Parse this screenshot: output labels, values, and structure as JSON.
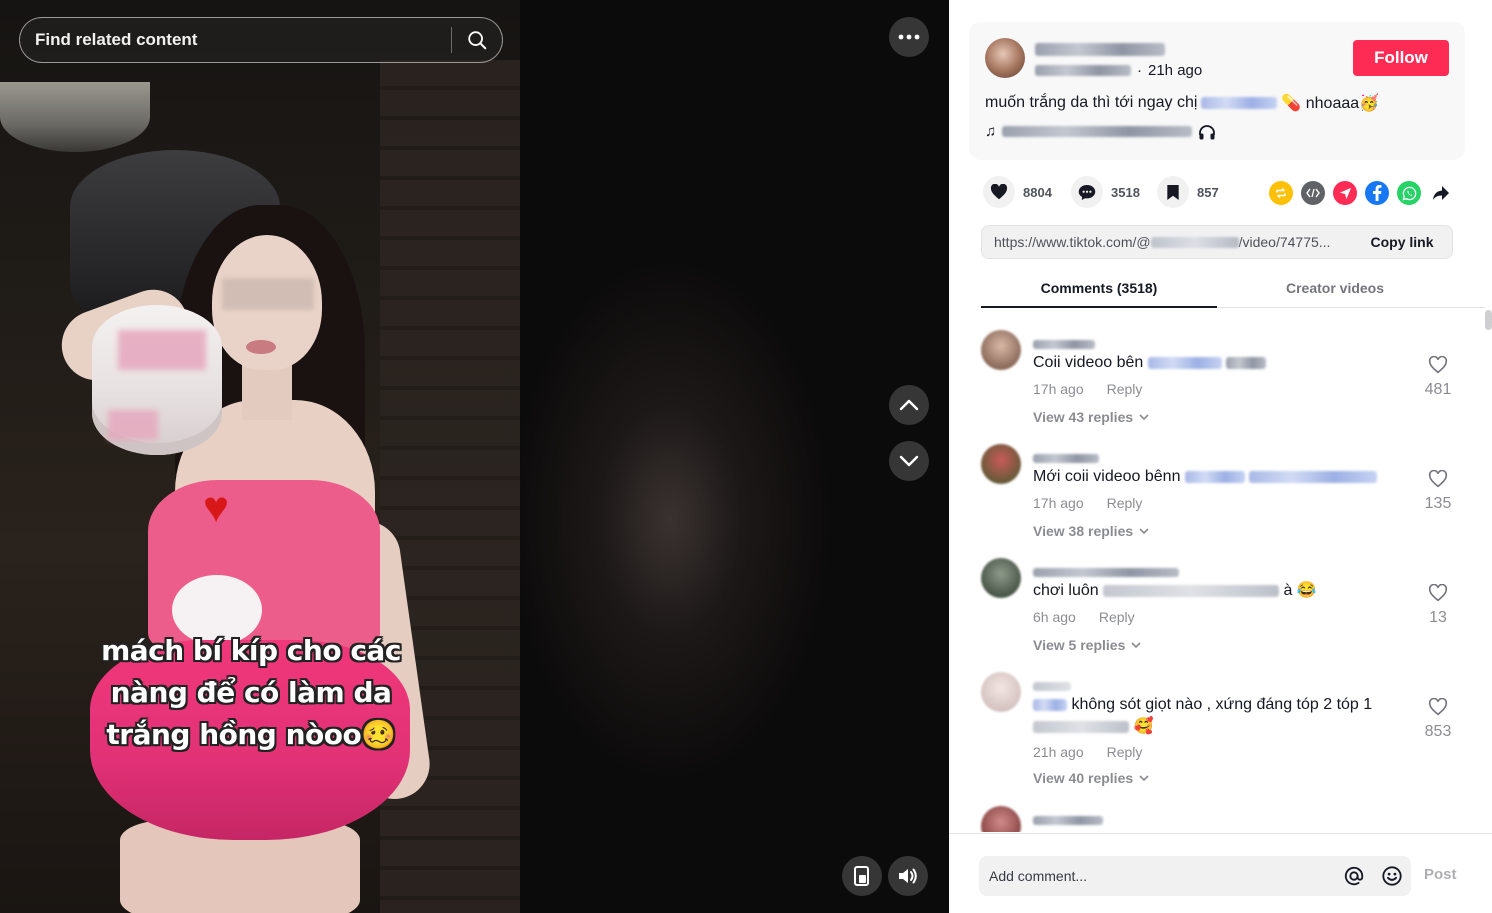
{
  "search": {
    "placeholder": "Find related content"
  },
  "video": {
    "caption_lines": [
      "mách bí kíp cho các",
      "nàng để có làm da",
      "trắng hồng nòoo🥴"
    ]
  },
  "post": {
    "time_ago": "21h ago",
    "follow_label": "Follow",
    "description_start": "muốn trắng da thì tới ngay chị",
    "description_end": "💊 nhoaaa🥳",
    "music_note": "♫",
    "likes": "8804",
    "comments": "3518",
    "saves": "857",
    "link_start": "https://www.tiktok.com/@",
    "link_end": "/video/74775...",
    "copy_label": "Copy link"
  },
  "tabs": {
    "comments": "Comments (3518)",
    "creator": "Creator videos"
  },
  "comments": [
    {
      "text_start": "Coii videoo bên",
      "time": "17h ago",
      "reply": "Reply",
      "replies": "View 43 replies",
      "likes": "481"
    },
    {
      "text_start": "Mới coii videoo bênn",
      "time": "17h ago",
      "reply": "Reply",
      "replies": "View 38 replies",
      "likes": "135"
    },
    {
      "text_start": "chơi luôn",
      "text_end": "à 😂",
      "time": "6h ago",
      "reply": "Reply",
      "replies": "View 5 replies",
      "likes": "13"
    },
    {
      "text_start": "không sót giọt nào , xứng đáng tóp 2 tóp 1",
      "text_end": "🥰",
      "time": "21h ago",
      "reply": "Reply",
      "replies": "View 40 replies",
      "likes": "853"
    }
  ],
  "composer": {
    "placeholder": "Add comment...",
    "post_label": "Post"
  },
  "colors": {
    "accent": "#fe2c55",
    "share_repost": "#ffc107",
    "share_embed": "#5f6368",
    "share_send": "#fe2c55",
    "share_facebook": "#1877f2",
    "share_whatsapp": "#25d366"
  },
  "icons": [
    "search-icon",
    "more-icon",
    "chevron-up-icon",
    "chevron-down-icon",
    "pip-icon",
    "volume-icon",
    "heart-icon",
    "comment-icon",
    "bookmark-icon",
    "repost-icon",
    "embed-icon",
    "send-icon",
    "facebook-icon",
    "whatsapp-icon",
    "share-arrow-icon",
    "headphones-icon",
    "mention-icon",
    "emoji-icon"
  ]
}
